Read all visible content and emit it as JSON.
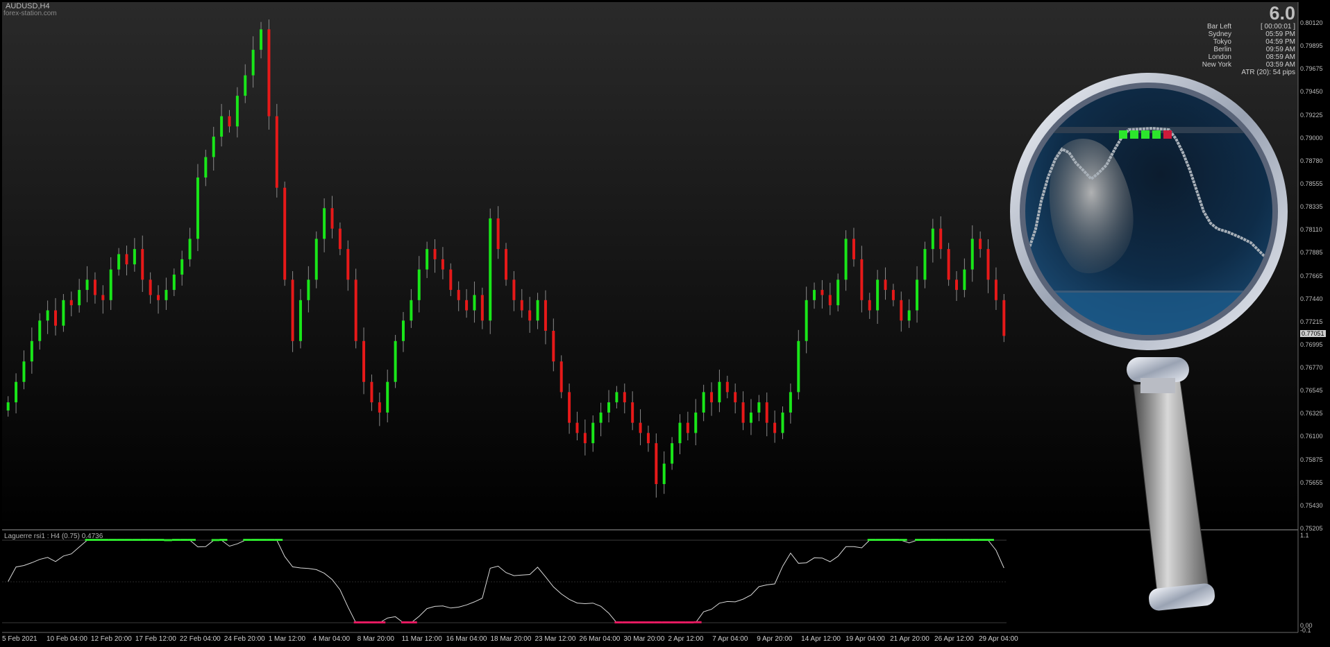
{
  "header": {
    "symbol": "AUDUSD,H4",
    "site": "forex-station.com",
    "version": "6.0"
  },
  "info_panel": [
    {
      "label": "Bar Left",
      "value": "[ 00:00:01 ]"
    },
    {
      "label": "Sydney",
      "value": "05:59 PM"
    },
    {
      "label": "Tokyo",
      "value": "04:59 PM"
    },
    {
      "label": "Berlin",
      "value": "09:59 AM"
    },
    {
      "label": "London",
      "value": "08:59 AM"
    },
    {
      "label": "New York",
      "value": "03:59 AM"
    },
    {
      "label": "",
      "value": "ATR (20): 54 pips"
    }
  ],
  "price_axis": [
    "0.80120",
    "0.79895",
    "0.79675",
    "0.79450",
    "0.79225",
    "0.79000",
    "0.78780",
    "0.78555",
    "0.78335",
    "0.78110",
    "0.77885",
    "0.77665",
    "0.77440",
    "0.77215",
    "0.76995",
    "0.76770",
    "0.76545",
    "0.76325",
    "0.76100",
    "0.75875",
    "0.75655",
    "0.75430",
    "0.75205"
  ],
  "current_price": "0.77051",
  "time_axis": [
    "5 Feb 2021",
    "10 Feb 04:00",
    "12 Feb 20:00",
    "17 Feb 12:00",
    "22 Feb 04:00",
    "24 Feb 20:00",
    "1 Mar 12:00",
    "4 Mar 04:00",
    "8 Mar 20:00",
    "11 Mar 12:00",
    "16 Mar 04:00",
    "18 Mar 20:00",
    "23 Mar 12:00",
    "26 Mar 04:00",
    "30 Mar 20:00",
    "2 Apr 12:00",
    "7 Apr 04:00",
    "9 Apr 20:00",
    "14 Apr 12:00",
    "19 Apr 04:00",
    "21 Apr 20:00",
    "26 Apr 12:00",
    "29 Apr 04:00"
  ],
  "subwindow": {
    "label": "Laguerre rsi1 : H4 (0.75) 0.4736",
    "scale_top": "1.1",
    "scale_bottom": "0.00",
    "scale_bottom2": "-0.1"
  },
  "colors": {
    "bull": "#19e619",
    "bear": "#e61919",
    "indicator_line": "#d8d8d8",
    "bg_top": "#2a2a2a",
    "bg_bottom": "#000000"
  },
  "magnifier": {
    "icon": "magnifying-glass-icon"
  },
  "chart_data": {
    "type": "candlestick",
    "series_close": [
      0.764,
      0.766,
      0.768,
      0.77,
      0.772,
      0.773,
      0.7715,
      0.774,
      0.7735,
      0.775,
      0.776,
      0.7745,
      0.774,
      0.777,
      0.7785,
      0.7775,
      0.779,
      0.776,
      0.7745,
      0.774,
      0.775,
      0.7765,
      0.778,
      0.78,
      0.786,
      0.788,
      0.79,
      0.792,
      0.791,
      0.794,
      0.796,
      0.7985,
      0.8005,
      0.792,
      0.785,
      0.776,
      0.77,
      0.774,
      0.776,
      0.78,
      0.783,
      0.781,
      0.779,
      0.776,
      0.77,
      0.766,
      0.764,
      0.763,
      0.766,
      0.77,
      0.772,
      0.774,
      0.777,
      0.779,
      0.778,
      0.777,
      0.775,
      0.774,
      0.773,
      0.7745,
      0.772,
      0.782,
      0.779,
      0.776,
      0.774,
      0.773,
      0.772,
      0.774,
      0.771,
      0.768,
      0.765,
      0.762,
      0.761,
      0.76,
      0.762,
      0.763,
      0.764,
      0.765,
      0.764,
      0.762,
      0.761,
      0.76,
      0.756,
      0.758,
      0.76,
      0.762,
      0.761,
      0.763,
      0.765,
      0.764,
      0.766,
      0.765,
      0.764,
      0.762,
      0.763,
      0.764,
      0.762,
      0.761,
      0.763,
      0.765,
      0.77,
      0.774,
      0.775,
      0.7745,
      0.7735,
      0.776,
      0.78,
      0.778,
      0.774,
      0.773,
      0.776,
      0.775,
      0.774,
      0.772,
      0.773,
      0.776,
      0.779,
      0.781,
      0.779,
      0.776,
      0.775,
      0.777,
      0.78,
      0.779,
      0.776,
      0.774,
      0.7705
    ],
    "subwindow_type": "line",
    "subwindow_ylim": [
      -0.1,
      1.1
    ]
  }
}
